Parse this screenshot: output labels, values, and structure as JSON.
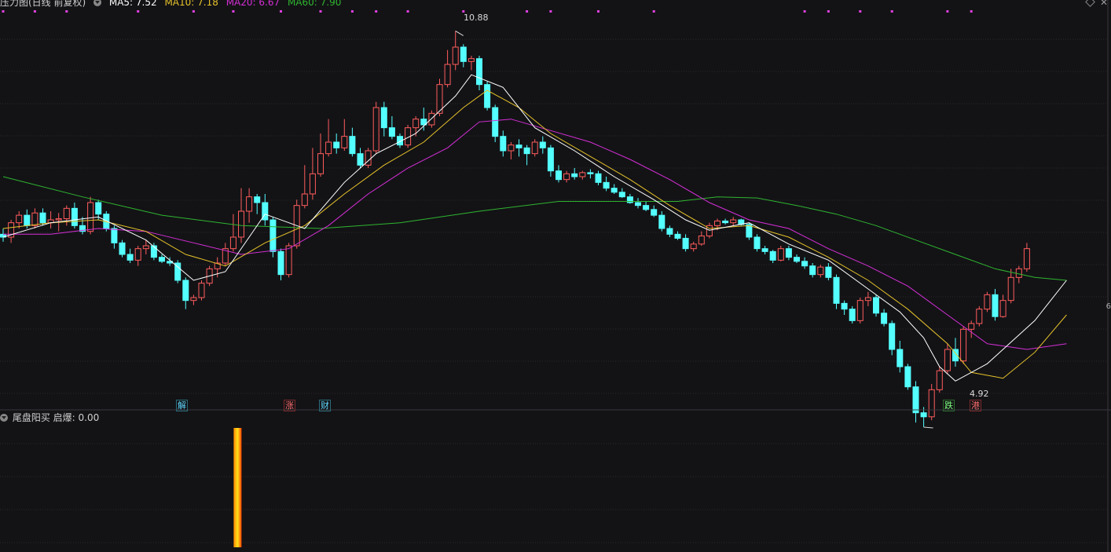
{
  "main_panel": {
    "title": "压力图(日线 前复权)",
    "ma": [
      {
        "label": "MA5: 7.52",
        "color": "#ffffff"
      },
      {
        "label": "MA10: 7.18",
        "color": "#e6c229"
      },
      {
        "label": "MA20: 6.67",
        "color": "#d62ed6"
      },
      {
        "label": "MA60: 7.90",
        "color": "#2fb52f"
      }
    ],
    "high_label": "10.88",
    "low_label": "4.92",
    "events": [
      {
        "text": "解",
        "color": "#5fd7ff",
        "border": "#2a6b78"
      },
      {
        "text": "涨",
        "color": "#ff6b6b",
        "border": "#7a2a2a"
      },
      {
        "text": "财",
        "color": "#5fd7ff",
        "border": "#2a6b78"
      },
      {
        "text": "跌",
        "color": "#7dff7d",
        "border": "#2a6b2a"
      },
      {
        "text": "港",
        "color": "#ff6b6b",
        "border": "#7a2a2a"
      }
    ],
    "right_edge_label": "6"
  },
  "indicator_panel": {
    "title": "尾盘阳买",
    "value_label": "启爆: 0.00"
  },
  "colors": {
    "up": "#ff5c5c",
    "down": "#54ffff",
    "grid": "#2a2a2e",
    "signal_dot": "#e040e0"
  },
  "chart_data": {
    "type": "candlestick",
    "price_range": [
      4.6,
      11.2
    ],
    "candles": [
      [
        7.35,
        7.45,
        7.22,
        7.3
      ],
      [
        7.3,
        7.6,
        7.2,
        7.55
      ],
      [
        7.55,
        7.75,
        7.45,
        7.68
      ],
      [
        7.68,
        7.78,
        7.45,
        7.5
      ],
      [
        7.5,
        7.8,
        7.45,
        7.72
      ],
      [
        7.72,
        7.8,
        7.5,
        7.55
      ],
      [
        7.55,
        7.75,
        7.45,
        7.6
      ],
      [
        7.6,
        7.72,
        7.4,
        7.62
      ],
      [
        7.62,
        7.85,
        7.5,
        7.8
      ],
      [
        7.8,
        7.9,
        7.45,
        7.5
      ],
      [
        7.5,
        7.65,
        7.35,
        7.4
      ],
      [
        7.4,
        8.0,
        7.35,
        7.9
      ],
      [
        7.9,
        7.95,
        7.6,
        7.7
      ],
      [
        7.7,
        7.75,
        7.4,
        7.45
      ],
      [
        7.45,
        7.5,
        7.1,
        7.2
      ],
      [
        7.2,
        7.25,
        6.95,
        7.0
      ],
      [
        7.0,
        7.1,
        6.85,
        6.9
      ],
      [
        6.9,
        7.15,
        6.8,
        7.1
      ],
      [
        7.1,
        7.25,
        7.0,
        7.15
      ],
      [
        7.15,
        7.2,
        6.9,
        6.95
      ],
      [
        6.95,
        7.0,
        6.85,
        6.88
      ],
      [
        6.88,
        6.95,
        6.8,
        6.85
      ],
      [
        6.85,
        6.9,
        6.5,
        6.55
      ],
      [
        6.55,
        6.6,
        6.05,
        6.2
      ],
      [
        6.2,
        6.3,
        6.12,
        6.25
      ],
      [
        6.25,
        6.55,
        6.2,
        6.5
      ],
      [
        6.5,
        6.8,
        6.45,
        6.75
      ],
      [
        6.75,
        6.95,
        6.6,
        6.85
      ],
      [
        6.85,
        7.2,
        6.8,
        7.1
      ],
      [
        7.1,
        7.7,
        7.05,
        7.3
      ],
      [
        7.3,
        8.15,
        7.2,
        7.75
      ],
      [
        7.75,
        8.15,
        7.55,
        8.0
      ],
      [
        8.0,
        8.05,
        7.7,
        7.9
      ],
      [
        7.9,
        8.05,
        7.5,
        7.6
      ],
      [
        7.6,
        7.65,
        6.95,
        7.05
      ],
      [
        7.05,
        7.1,
        6.55,
        6.65
      ],
      [
        6.65,
        7.2,
        6.6,
        7.15
      ],
      [
        7.15,
        7.95,
        7.1,
        7.85
      ],
      [
        7.85,
        8.55,
        7.8,
        8.05
      ],
      [
        8.05,
        8.85,
        7.95,
        8.4
      ],
      [
        8.4,
        9.1,
        8.35,
        8.75
      ],
      [
        8.75,
        9.35,
        8.7,
        8.95
      ],
      [
        8.95,
        9.1,
        8.75,
        8.85
      ],
      [
        8.85,
        9.35,
        8.8,
        9.05
      ],
      [
        9.05,
        9.2,
        8.7,
        8.75
      ],
      [
        8.75,
        8.85,
        8.5,
        8.55
      ],
      [
        8.55,
        8.85,
        8.5,
        8.8
      ],
      [
        8.8,
        9.65,
        8.75,
        9.55
      ],
      [
        9.55,
        9.65,
        9.05,
        9.2
      ],
      [
        9.2,
        9.4,
        9.0,
        9.05
      ],
      [
        9.05,
        9.1,
        8.85,
        8.9
      ],
      [
        8.9,
        9.25,
        8.85,
        9.2
      ],
      [
        9.2,
        9.4,
        9.05,
        9.35
      ],
      [
        9.35,
        9.55,
        9.15,
        9.25
      ],
      [
        9.25,
        9.5,
        9.2,
        9.45
      ],
      [
        9.45,
        10.05,
        9.4,
        9.95
      ],
      [
        9.95,
        10.55,
        9.9,
        10.3
      ],
      [
        10.3,
        10.88,
        10.2,
        10.6
      ],
      [
        10.6,
        10.65,
        10.25,
        10.35
      ],
      [
        10.35,
        10.45,
        10.2,
        10.4
      ],
      [
        10.4,
        10.45,
        9.85,
        9.95
      ],
      [
        9.95,
        10.0,
        9.5,
        9.55
      ],
      [
        9.55,
        9.6,
        8.95,
        9.05
      ],
      [
        9.05,
        9.15,
        8.7,
        8.8
      ],
      [
        8.8,
        8.95,
        8.65,
        8.9
      ],
      [
        8.9,
        9.0,
        8.7,
        8.85
      ],
      [
        8.85,
        8.9,
        8.55,
        8.75
      ],
      [
        8.75,
        9.0,
        8.7,
        8.95
      ],
      [
        8.95,
        9.05,
        8.75,
        8.85
      ],
      [
        8.85,
        8.9,
        8.35,
        8.45
      ],
      [
        8.45,
        8.55,
        8.25,
        8.3
      ],
      [
        8.3,
        8.45,
        8.25,
        8.4
      ],
      [
        8.4,
        8.5,
        8.3,
        8.35
      ],
      [
        8.35,
        8.45,
        8.3,
        8.42
      ],
      [
        8.42,
        8.48,
        8.32,
        8.4
      ],
      [
        8.4,
        8.45,
        8.2,
        8.25
      ],
      [
        8.25,
        8.35,
        8.1,
        8.15
      ],
      [
        8.15,
        8.22,
        8.05,
        8.08
      ],
      [
        8.08,
        8.15,
        7.98,
        8.0
      ],
      [
        8.0,
        8.05,
        7.88,
        7.9
      ],
      [
        7.9,
        7.98,
        7.8,
        7.85
      ],
      [
        7.85,
        7.92,
        7.75,
        7.78
      ],
      [
        7.78,
        7.85,
        7.65,
        7.68
      ],
      [
        7.68,
        7.75,
        7.4,
        7.45
      ],
      [
        7.45,
        7.5,
        7.3,
        7.35
      ],
      [
        7.35,
        7.4,
        7.25,
        7.28
      ],
      [
        7.28,
        7.35,
        7.05,
        7.1
      ],
      [
        7.1,
        7.22,
        7.05,
        7.18
      ],
      [
        7.18,
        7.4,
        7.15,
        7.32
      ],
      [
        7.32,
        7.55,
        7.28,
        7.5
      ],
      [
        7.5,
        7.62,
        7.42,
        7.58
      ],
      [
        7.58,
        7.62,
        7.52,
        7.55
      ],
      [
        7.55,
        7.65,
        7.5,
        7.6
      ],
      [
        7.6,
        7.62,
        7.5,
        7.52
      ],
      [
        7.52,
        7.55,
        7.25,
        7.3
      ],
      [
        7.3,
        7.35,
        7.05,
        7.1
      ],
      [
        7.1,
        7.15,
        7.0,
        7.05
      ],
      [
        7.05,
        7.08,
        6.85,
        6.9
      ],
      [
        6.9,
        7.15,
        6.88,
        7.1
      ],
      [
        7.1,
        7.15,
        6.9,
        6.95
      ],
      [
        6.95,
        7.0,
        6.85,
        6.88
      ],
      [
        6.88,
        6.95,
        6.75,
        6.8
      ],
      [
        6.8,
        6.85,
        6.6,
        6.65
      ],
      [
        6.65,
        6.82,
        6.6,
        6.78
      ],
      [
        6.78,
        6.85,
        6.55,
        6.6
      ],
      [
        6.6,
        6.65,
        6.05,
        6.15
      ],
      [
        6.15,
        6.2,
        5.95,
        6.05
      ],
      [
        6.05,
        6.1,
        5.8,
        5.85
      ],
      [
        5.85,
        6.25,
        5.8,
        6.2
      ],
      [
        6.2,
        6.35,
        6.1,
        6.25
      ],
      [
        6.25,
        6.3,
        5.92,
        5.98
      ],
      [
        5.98,
        6.05,
        5.75,
        5.8
      ],
      [
        5.8,
        5.85,
        5.25,
        5.35
      ],
      [
        5.35,
        5.5,
        4.95,
        5.05
      ],
      [
        5.05,
        5.1,
        4.65,
        4.7
      ],
      [
        4.7,
        4.8,
        4.08,
        4.25
      ],
      [
        4.25,
        4.35,
        4.0,
        4.18
      ],
      [
        4.18,
        4.75,
        4.12,
        4.65
      ],
      [
        4.65,
        5.05,
        4.6,
        4.98
      ],
      [
        4.98,
        5.45,
        4.92,
        5.35
      ],
      [
        5.35,
        5.55,
        5.05,
        5.15
      ],
      [
        5.15,
        5.75,
        5.1,
        5.7
      ],
      [
        5.7,
        5.85,
        5.55,
        5.8
      ],
      [
        5.8,
        6.1,
        5.75,
        6.05
      ],
      [
        6.05,
        6.35,
        6.0,
        6.3
      ],
      [
        6.3,
        6.4,
        5.85,
        5.92
      ],
      [
        5.92,
        6.3,
        5.9,
        6.2
      ],
      [
        6.2,
        6.75,
        6.15,
        6.6
      ],
      [
        6.6,
        6.8,
        6.5,
        6.75
      ],
      [
        6.75,
        7.2,
        6.7,
        7.1
      ]
    ],
    "ma5": [
      [
        0,
        7.3
      ],
      [
        6,
        7.55
      ],
      [
        12,
        7.65
      ],
      [
        18,
        7.25
      ],
      [
        24,
        6.55
      ],
      [
        28,
        6.7
      ],
      [
        33,
        7.7
      ],
      [
        38,
        7.45
      ],
      [
        43,
        8.25
      ],
      [
        47,
        8.75
      ],
      [
        52,
        9.1
      ],
      [
        57,
        9.75
      ],
      [
        59,
        10.12
      ],
      [
        63,
        9.9
      ],
      [
        67,
        9.2
      ],
      [
        72,
        8.8
      ],
      [
        77,
        8.35
      ],
      [
        82,
        7.95
      ],
      [
        86,
        7.6
      ],
      [
        89,
        7.42
      ],
      [
        94,
        7.55
      ],
      [
        99,
        7.18
      ],
      [
        104,
        6.9
      ],
      [
        109,
        6.4
      ],
      [
        113,
        6.0
      ],
      [
        116,
        5.55
      ],
      [
        118,
        5.05
      ],
      [
        120,
        4.8
      ],
      [
        124,
        5.1
      ],
      [
        130,
        5.85
      ],
      [
        134,
        6.55
      ]
    ],
    "ma10": [
      [
        0,
        7.45
      ],
      [
        6,
        7.55
      ],
      [
        12,
        7.6
      ],
      [
        18,
        7.4
      ],
      [
        23,
        7.0
      ],
      [
        28,
        6.8
      ],
      [
        33,
        7.2
      ],
      [
        38,
        7.5
      ],
      [
        43,
        8.05
      ],
      [
        48,
        8.55
      ],
      [
        53,
        8.95
      ],
      [
        58,
        9.55
      ],
      [
        61,
        9.85
      ],
      [
        65,
        9.55
      ],
      [
        69,
        9.1
      ],
      [
        74,
        8.7
      ],
      [
        79,
        8.3
      ],
      [
        84,
        7.85
      ],
      [
        89,
        7.45
      ],
      [
        94,
        7.5
      ],
      [
        99,
        7.3
      ],
      [
        104,
        6.95
      ],
      [
        109,
        6.55
      ],
      [
        114,
        6.05
      ],
      [
        119,
        5.45
      ],
      [
        122,
        4.95
      ],
      [
        126,
        4.85
      ],
      [
        130,
        5.3
      ],
      [
        134,
        5.95
      ]
    ],
    "ma20": [
      [
        0,
        7.35
      ],
      [
        6,
        7.35
      ],
      [
        12,
        7.45
      ],
      [
        18,
        7.4
      ],
      [
        24,
        7.2
      ],
      [
        30,
        7.0
      ],
      [
        36,
        7.1
      ],
      [
        41,
        7.5
      ],
      [
        46,
        8.05
      ],
      [
        51,
        8.5
      ],
      [
        56,
        8.85
      ],
      [
        60,
        9.3
      ],
      [
        64,
        9.35
      ],
      [
        69,
        9.15
      ],
      [
        74,
        8.95
      ],
      [
        79,
        8.65
      ],
      [
        84,
        8.3
      ],
      [
        89,
        7.9
      ],
      [
        94,
        7.6
      ],
      [
        99,
        7.45
      ],
      [
        104,
        7.1
      ],
      [
        109,
        6.8
      ],
      [
        114,
        6.45
      ],
      [
        119,
        5.95
      ],
      [
        124,
        5.45
      ],
      [
        129,
        5.35
      ],
      [
        134,
        5.45
      ]
    ],
    "ma60": [
      [
        0,
        8.35
      ],
      [
        10,
        8.0
      ],
      [
        20,
        7.68
      ],
      [
        30,
        7.5
      ],
      [
        40,
        7.45
      ],
      [
        50,
        7.55
      ],
      [
        60,
        7.75
      ],
      [
        70,
        7.92
      ],
      [
        80,
        7.92
      ],
      [
        85,
        7.92
      ],
      [
        90,
        8.0
      ],
      [
        95,
        7.98
      ],
      [
        100,
        7.85
      ],
      [
        105,
        7.7
      ],
      [
        110,
        7.5
      ],
      [
        115,
        7.25
      ],
      [
        120,
        7.0
      ],
      [
        125,
        6.75
      ],
      [
        130,
        6.6
      ],
      [
        134,
        6.55
      ]
    ],
    "event_markers": [
      {
        "index": 19,
        "text": "解"
      },
      {
        "index": 30,
        "text": "涨"
      },
      {
        "index": 34,
        "text": "财"
      },
      {
        "index": 101,
        "text": "跌"
      },
      {
        "index": 104,
        "text": "港"
      }
    ],
    "signal_dots_top": [
      0,
      4,
      8,
      17,
      24,
      29,
      35,
      40,
      44,
      47,
      51,
      58,
      66,
      69,
      75,
      82,
      101,
      104,
      108,
      112,
      119,
      122
    ],
    "indicator": {
      "name": "启爆",
      "value": 0.0,
      "bars": [
        {
          "index": 24,
          "value": 1
        }
      ]
    }
  }
}
